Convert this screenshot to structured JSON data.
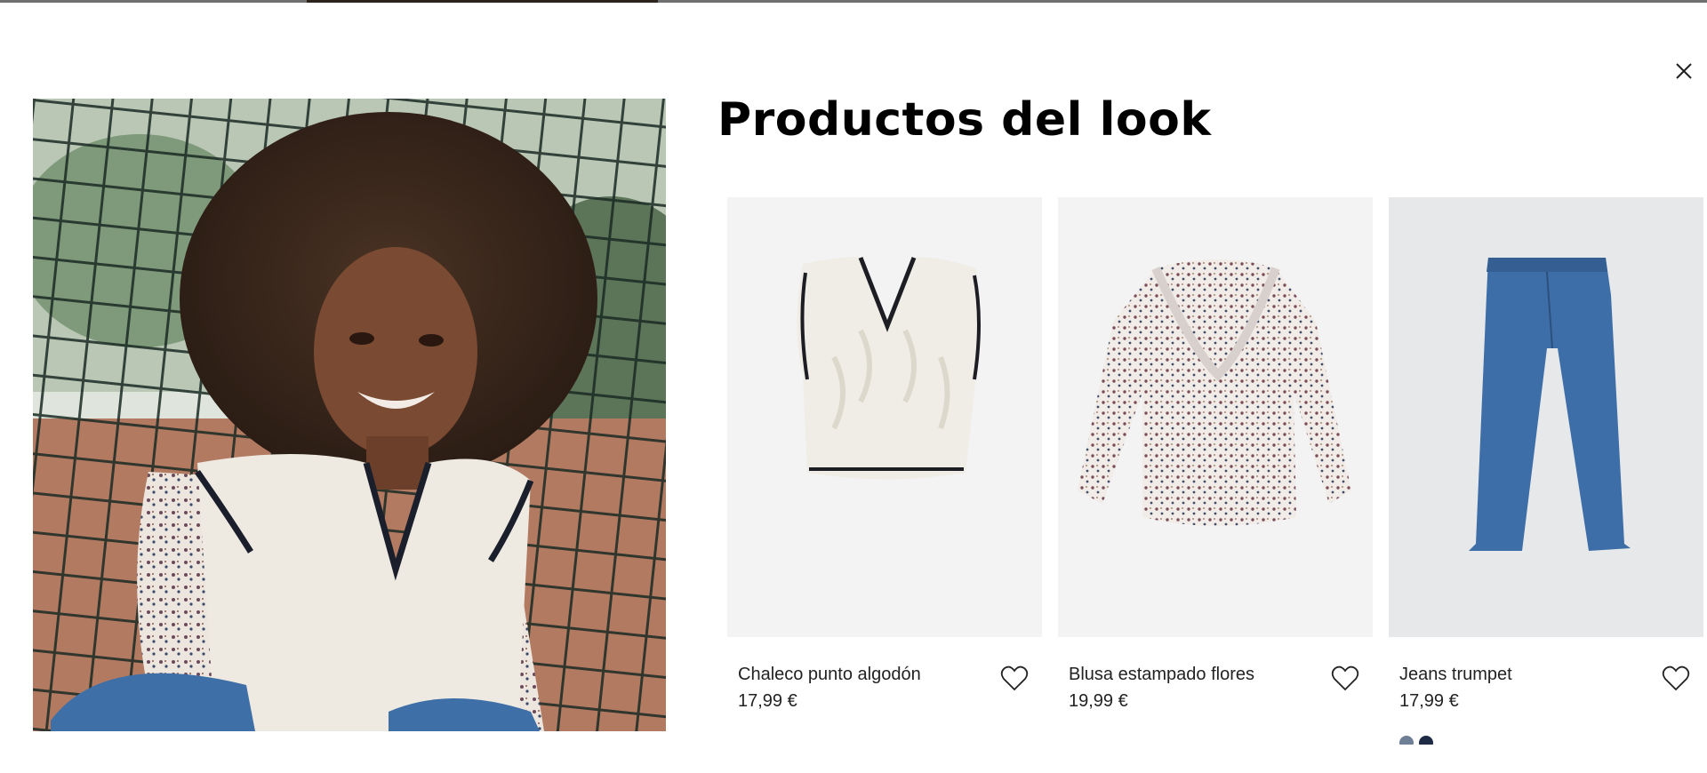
{
  "modal": {
    "title": "Productos del look",
    "close_icon": "close-icon"
  },
  "look_image": {
    "subject": "girl-look-photo"
  },
  "products": [
    {
      "name": "Chaleco punto algodón",
      "price": "17,99 €",
      "favorite_icon": "heart-outline-icon"
    },
    {
      "name": "Blusa estampado flores",
      "price": "19,99 €",
      "favorite_icon": "heart-outline-icon"
    },
    {
      "name": "Jeans trumpet",
      "price": "17,99 €",
      "favorite_icon": "heart-outline-icon",
      "color_swatches": [
        "#6f7f95",
        "#1f2a44"
      ]
    }
  ],
  "colors": {
    "background": "#ffffff",
    "text": "#222222",
    "title": "#000000",
    "product_bg": "#f2f2f3",
    "denim": "#3d6ea8"
  }
}
